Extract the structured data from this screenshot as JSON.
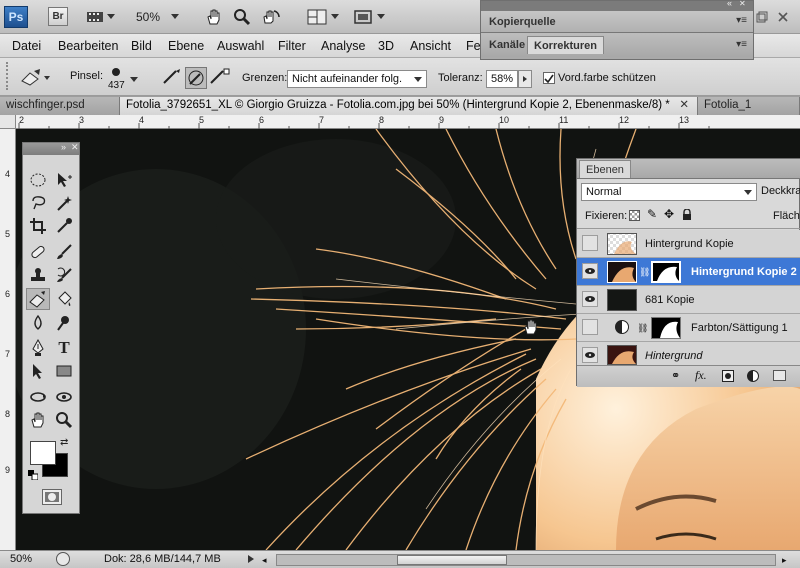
{
  "app": {
    "logo": "Ps",
    "bridge": "Br",
    "zoom": "50%"
  },
  "menu": [
    "Datei",
    "Bearbeiten",
    "Bild",
    "Ebene",
    "Auswahl",
    "Filter",
    "Analyse",
    "3D",
    "Ansicht",
    "Fe"
  ],
  "options": {
    "brush_label": "Pinsel:",
    "brush_size": "437",
    "limits_label": "Grenzen:",
    "limits_value": "Nicht aufeinander folg.",
    "tolerance_label": "Toleranz:",
    "tolerance_value": "58%",
    "protect_fg_label": "Vord.farbe schützen",
    "protect_fg_checked": true
  },
  "tabs": [
    {
      "label": "wischfinger.psd",
      "active": false
    },
    {
      "label": "Fotolia_3792651_XL © Giorgio Gruizza - Fotolia.com.jpg bei 50% (Hintergrund Kopie 2, Ebenenmaske/8) *",
      "active": true
    },
    {
      "label": "Fotolia_1",
      "active": false
    }
  ],
  "ruler": {
    "h": [
      "2",
      "3",
      "4",
      "5",
      "6",
      "7",
      "8",
      "9",
      "10",
      "11",
      "12",
      "13"
    ],
    "v": [
      "4",
      "5",
      "6",
      "7",
      "8",
      "9"
    ]
  },
  "status": {
    "zoom": "50%",
    "doc": "Dok: 28,6 MB/144,7 MB"
  },
  "panels": {
    "kopierquelle": "Kopierquelle",
    "kanaele": "Kanäle",
    "korrekturen": "Korrekturen"
  },
  "layers_panel": {
    "tab": "Ebenen",
    "blend_mode": "Normal",
    "opacity_label": "Deckkra",
    "lock_label": "Fixieren:",
    "fill_label": "Fläche",
    "layers": [
      {
        "name": "Hintergrund Kopie",
        "visible": false,
        "active": false,
        "mask": false,
        "adjust": false,
        "italic": false
      },
      {
        "name": "Hintergrund Kopie 2",
        "visible": true,
        "active": true,
        "mask": true,
        "adjust": false,
        "italic": false
      },
      {
        "name": "681 Kopie",
        "visible": true,
        "active": false,
        "mask": false,
        "adjust": false,
        "italic": false
      },
      {
        "name": "Farbton/Sättigung 1",
        "visible": false,
        "active": false,
        "mask": true,
        "adjust": true,
        "italic": false
      },
      {
        "name": "Hintergrund",
        "visible": true,
        "active": false,
        "mask": false,
        "adjust": false,
        "italic": true
      }
    ]
  },
  "colors": {
    "accent": "#3d78d6",
    "canvas_bg": "#121312",
    "hair": "#f3b878"
  }
}
